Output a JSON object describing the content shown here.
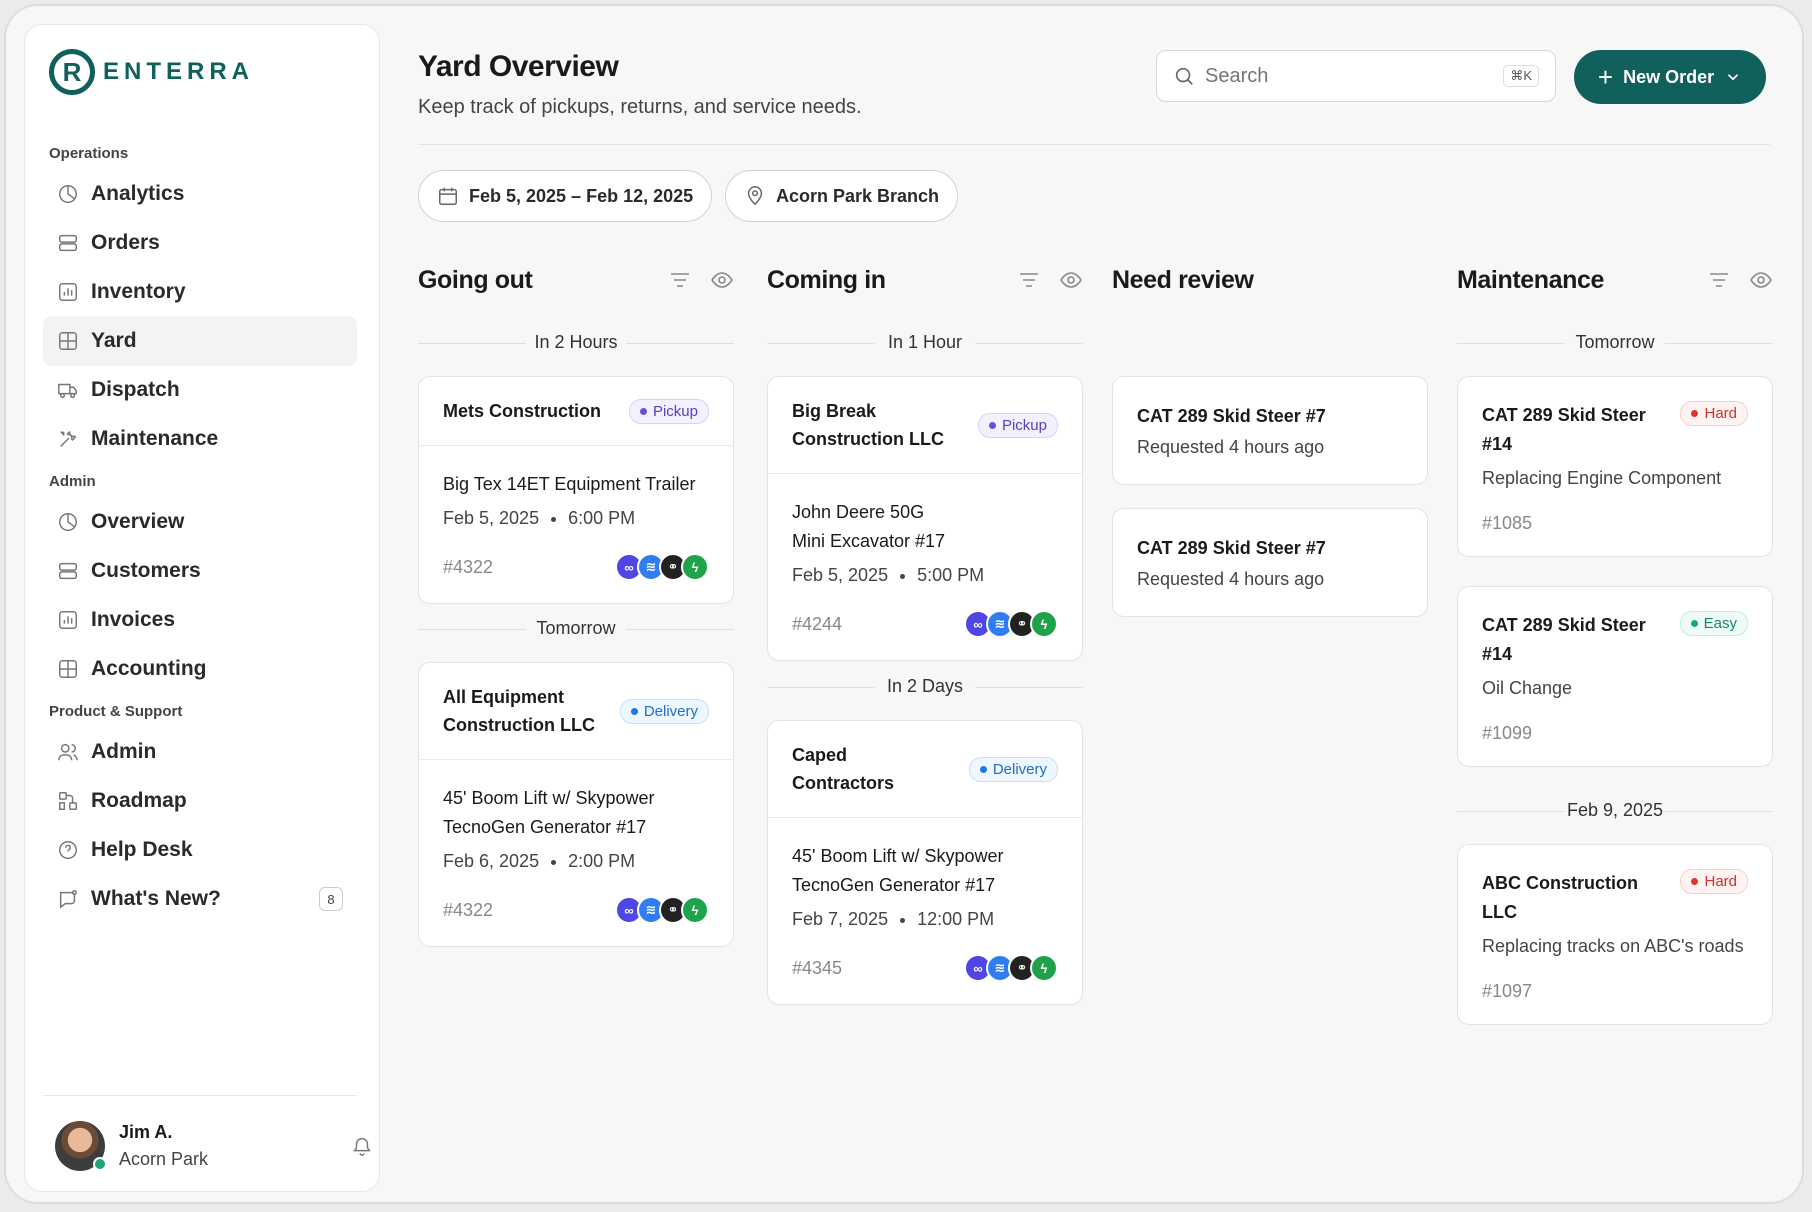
{
  "brand": {
    "name": "ENTERRA",
    "mark": "R"
  },
  "sidebar": {
    "sections": [
      "Operations",
      "Admin",
      "Product & Support"
    ],
    "items": [
      {
        "label": "Analytics",
        "icon": "pie-chart-icon"
      },
      {
        "label": "Orders",
        "icon": "stack-icon"
      },
      {
        "label": "Inventory",
        "icon": "bar-chart-icon"
      },
      {
        "label": "Yard",
        "icon": "grid-icon"
      },
      {
        "label": "Dispatch",
        "icon": "truck-icon"
      },
      {
        "label": "Maintenance",
        "icon": "tools-icon"
      },
      {
        "label": "Overview",
        "icon": "pie-chart-icon"
      },
      {
        "label": "Customers",
        "icon": "stack-icon"
      },
      {
        "label": "Invoices",
        "icon": "bar-chart-icon"
      },
      {
        "label": "Accounting",
        "icon": "grid-icon"
      },
      {
        "label": "Admin",
        "icon": "users-icon"
      },
      {
        "label": "Roadmap",
        "icon": "roadmap-icon"
      },
      {
        "label": "Help Desk",
        "icon": "help-icon"
      },
      {
        "label": "What's New?",
        "icon": "chat-icon",
        "badge": "8"
      }
    ],
    "user": {
      "name": "Jim A.",
      "branch": "Acorn Park"
    }
  },
  "header": {
    "title": "Yard Overview",
    "subtitle": "Keep track of pickups, returns, and service needs.",
    "search_placeholder": "Search",
    "search_shortcut": "⌘K",
    "new_order": "New Order"
  },
  "filters": {
    "date_range": "Feb 5, 2025 – Feb 12, 2025",
    "branch": "Acorn Park Branch"
  },
  "columns": {
    "going_out": {
      "title": "Going out",
      "groups": [
        "In 2 Hours",
        "Tomorrow"
      ],
      "cards": [
        {
          "customer": "Mets Construction",
          "tag": "Pickup",
          "item": "Big Tex 14ET Equipment Trailer",
          "date": "Feb 5, 2025",
          "time": "6:00 PM",
          "order": "#4322"
        },
        {
          "customer": "All Equipment Construction LLC",
          "tag": "Delivery",
          "item": "45' Boom Lift w/ Skypower TecnoGen Generator #17",
          "date": "Feb 6, 2025",
          "time": "2:00 PM",
          "order": "#4322"
        }
      ]
    },
    "coming_in": {
      "title": "Coming in",
      "groups": [
        "In 1 Hour",
        "In 2 Days"
      ],
      "cards": [
        {
          "customer": "Big Break Construction LLC",
          "tag": "Pickup",
          "item": "John Deere 50G Mini Excavator #17",
          "date": "Feb 5, 2025",
          "time": "5:00 PM",
          "order": "#4244"
        },
        {
          "customer": "Caped Contractors",
          "tag": "Delivery",
          "item": "45' Boom Lift w/ Skypower TecnoGen Generator #17",
          "date": "Feb 7, 2025",
          "time": "12:00 PM",
          "order": "#4345"
        }
      ]
    },
    "need_review": {
      "title": "Need review",
      "cards": [
        {
          "title": "CAT 289 Skid Steer #7",
          "sub": "Requested 4 hours ago"
        },
        {
          "title": "CAT 289 Skid Steer #7",
          "sub": "Requested 4 hours ago"
        }
      ]
    },
    "maintenance": {
      "title": "Maintenance",
      "groups": [
        "Tomorrow",
        "Feb 9, 2025"
      ],
      "cards": [
        {
          "title": "CAT 289 Skid Steer #14",
          "tag": "Hard",
          "desc": "Replacing Engine Component",
          "num": "#1085"
        },
        {
          "title": "CAT 289 Skid Steer #14",
          "tag": "Easy",
          "desc": "Oil Change",
          "num": "#1099"
        },
        {
          "title": "ABC Construction LLC",
          "tag": "Hard",
          "desc": "Replacing tracks on ABC's roads",
          "num": "#1097"
        }
      ]
    }
  },
  "colors": {
    "brand": "#10615c",
    "pickup": "#6a4fd8",
    "delivery": "#1d78e0",
    "hard": "#e0352c",
    "easy": "#19a878",
    "status_online": "#1ea672"
  }
}
